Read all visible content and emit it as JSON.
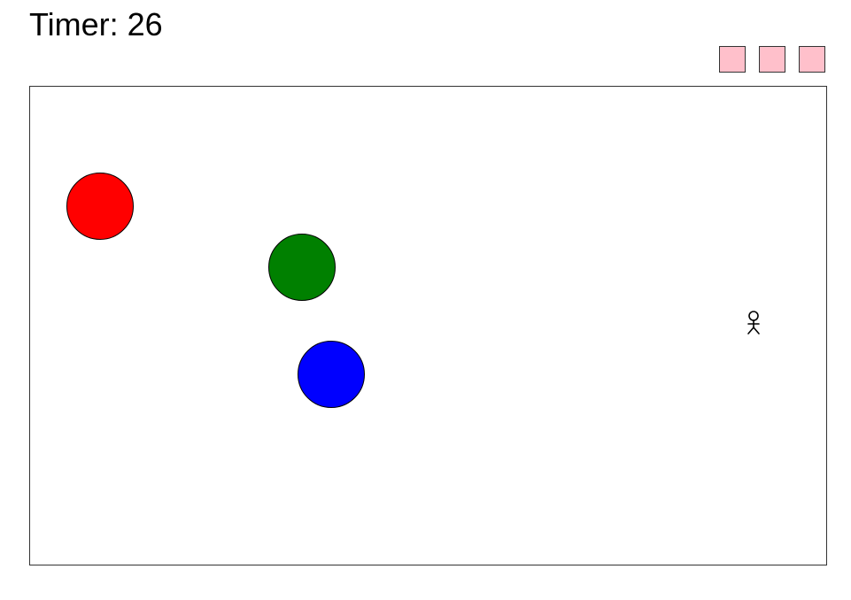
{
  "hud": {
    "timer_text": "Timer: 26"
  },
  "lives": {
    "count": 3,
    "color": "#FFC0CB"
  },
  "arena": {
    "border_color": "#333333",
    "background": "#FFFFFF"
  },
  "balls": [
    {
      "name": "red-ball",
      "color": "#FF0000"
    },
    {
      "name": "green-ball",
      "color": "#008000"
    },
    {
      "name": "blue-ball",
      "color": "#0000FF"
    }
  ],
  "player": {
    "icon": "stick-figure-icon",
    "color": "#000000"
  }
}
